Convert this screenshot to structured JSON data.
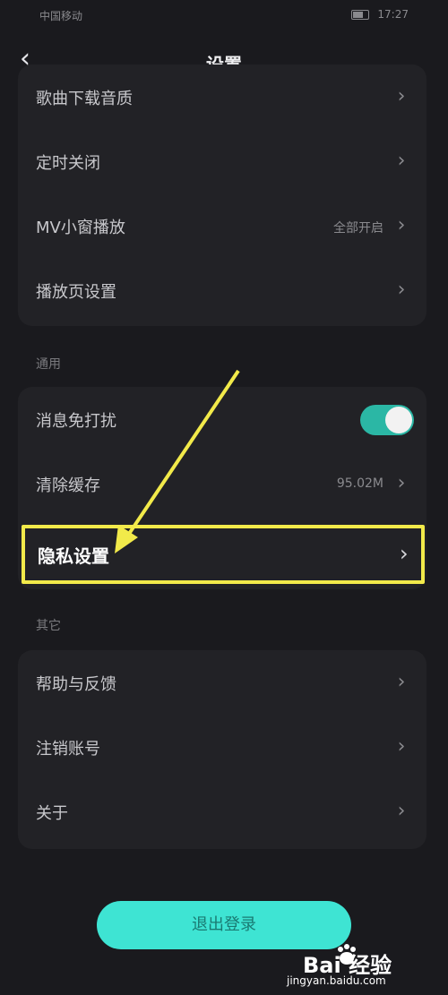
{
  "status_bar": {
    "carrier": "中国移动",
    "time": "17:27"
  },
  "nav": {
    "title": "设置"
  },
  "playback_card": {
    "items": [
      {
        "label": "歌曲下载音质"
      },
      {
        "label": "定时关闭"
      },
      {
        "label": "MV小窗播放",
        "value": "全部开启"
      },
      {
        "label": "播放页设置"
      }
    ]
  },
  "general_section": {
    "label": "通用",
    "items": [
      {
        "label": "消息免打扰",
        "toggle": true
      },
      {
        "label": "清除缓存",
        "value": "95.02M"
      },
      {
        "label": "隐私设置"
      }
    ]
  },
  "other_section": {
    "label": "其它",
    "items": [
      {
        "label": "帮助与反馈"
      },
      {
        "label": "注销账号"
      },
      {
        "label": "关于"
      }
    ]
  },
  "logout_button": {
    "label": "退出登录"
  },
  "watermark": {
    "brand": "Bai 经验",
    "url": "jingyan.baidu.com"
  },
  "colors": {
    "accent": "#3ee4d3",
    "toggle": "#2bb7a5",
    "highlight": "#f2ea4a"
  }
}
